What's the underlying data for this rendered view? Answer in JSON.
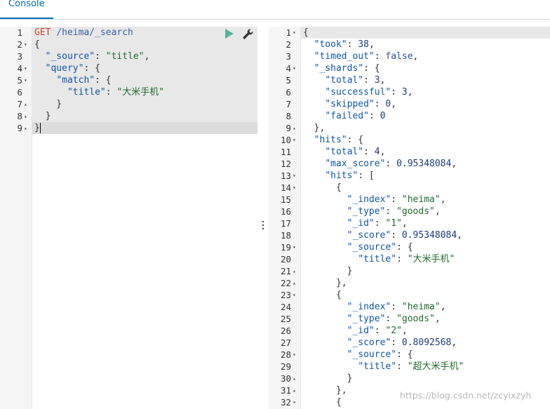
{
  "tabs": {
    "console_label": "Console"
  },
  "request": {
    "lines": [
      [
        {
          "t": "GET ",
          "c": "m"
        },
        {
          "t": "/heima/_search",
          "c": "u"
        }
      ],
      [
        {
          "t": "{",
          "c": "p"
        }
      ],
      [
        {
          "t": "  ",
          "c": "p"
        },
        {
          "t": "\"_source\"",
          "c": "k"
        },
        {
          "t": ": ",
          "c": "p"
        },
        {
          "t": "\"title\"",
          "c": "s"
        },
        {
          "t": ",",
          "c": "p"
        }
      ],
      [
        {
          "t": "  ",
          "c": "p"
        },
        {
          "t": "\"query\"",
          "c": "k"
        },
        {
          "t": ": {",
          "c": "p"
        }
      ],
      [
        {
          "t": "    ",
          "c": "p"
        },
        {
          "t": "\"match\"",
          "c": "k"
        },
        {
          "t": ": {",
          "c": "p"
        }
      ],
      [
        {
          "t": "      ",
          "c": "p"
        },
        {
          "t": "\"title\"",
          "c": "k"
        },
        {
          "t": ": ",
          "c": "p"
        },
        {
          "t": "\"大米手机\"",
          "c": "s"
        }
      ],
      [
        {
          "t": "    }",
          "c": "p"
        }
      ],
      [
        {
          "t": "  }",
          "c": "p"
        }
      ],
      [
        {
          "t": "}",
          "c": "p"
        }
      ]
    ],
    "folds": [
      "",
      "▾",
      "",
      "▾",
      "▾",
      "",
      "▴",
      "▴",
      "▴"
    ]
  },
  "response": {
    "lines": [
      [
        {
          "t": "{",
          "c": "p"
        }
      ],
      [
        {
          "t": "  ",
          "c": "p"
        },
        {
          "t": "\"took\"",
          "c": "k"
        },
        {
          "t": ": ",
          "c": "p"
        },
        {
          "t": "38",
          "c": "n"
        },
        {
          "t": ",",
          "c": "p"
        }
      ],
      [
        {
          "t": "  ",
          "c": "p"
        },
        {
          "t": "\"timed_out\"",
          "c": "k"
        },
        {
          "t": ": ",
          "c": "p"
        },
        {
          "t": "false",
          "c": "b"
        },
        {
          "t": ",",
          "c": "p"
        }
      ],
      [
        {
          "t": "  ",
          "c": "p"
        },
        {
          "t": "\"_shards\"",
          "c": "k"
        },
        {
          "t": ": {",
          "c": "p"
        }
      ],
      [
        {
          "t": "    ",
          "c": "p"
        },
        {
          "t": "\"total\"",
          "c": "k"
        },
        {
          "t": ": ",
          "c": "p"
        },
        {
          "t": "3",
          "c": "n"
        },
        {
          "t": ",",
          "c": "p"
        }
      ],
      [
        {
          "t": "    ",
          "c": "p"
        },
        {
          "t": "\"successful\"",
          "c": "k"
        },
        {
          "t": ": ",
          "c": "p"
        },
        {
          "t": "3",
          "c": "n"
        },
        {
          "t": ",",
          "c": "p"
        }
      ],
      [
        {
          "t": "    ",
          "c": "p"
        },
        {
          "t": "\"skipped\"",
          "c": "k"
        },
        {
          "t": ": ",
          "c": "p"
        },
        {
          "t": "0",
          "c": "n"
        },
        {
          "t": ",",
          "c": "p"
        }
      ],
      [
        {
          "t": "    ",
          "c": "p"
        },
        {
          "t": "\"failed\"",
          "c": "k"
        },
        {
          "t": ": ",
          "c": "p"
        },
        {
          "t": "0",
          "c": "n"
        }
      ],
      [
        {
          "t": "  },",
          "c": "p"
        }
      ],
      [
        {
          "t": "  ",
          "c": "p"
        },
        {
          "t": "\"hits\"",
          "c": "k"
        },
        {
          "t": ": {",
          "c": "p"
        }
      ],
      [
        {
          "t": "    ",
          "c": "p"
        },
        {
          "t": "\"total\"",
          "c": "k"
        },
        {
          "t": ": ",
          "c": "p"
        },
        {
          "t": "4",
          "c": "n"
        },
        {
          "t": ",",
          "c": "p"
        }
      ],
      [
        {
          "t": "    ",
          "c": "p"
        },
        {
          "t": "\"max_score\"",
          "c": "k"
        },
        {
          "t": ": ",
          "c": "p"
        },
        {
          "t": "0.95348084",
          "c": "n"
        },
        {
          "t": ",",
          "c": "p"
        }
      ],
      [
        {
          "t": "    ",
          "c": "p"
        },
        {
          "t": "\"hits\"",
          "c": "k"
        },
        {
          "t": ": [",
          "c": "p"
        }
      ],
      [
        {
          "t": "      {",
          "c": "p"
        }
      ],
      [
        {
          "t": "        ",
          "c": "p"
        },
        {
          "t": "\"_index\"",
          "c": "k"
        },
        {
          "t": ": ",
          "c": "p"
        },
        {
          "t": "\"heima\"",
          "c": "s"
        },
        {
          "t": ",",
          "c": "p"
        }
      ],
      [
        {
          "t": "        ",
          "c": "p"
        },
        {
          "t": "\"_type\"",
          "c": "k"
        },
        {
          "t": ": ",
          "c": "p"
        },
        {
          "t": "\"goods\"",
          "c": "s"
        },
        {
          "t": ",",
          "c": "p"
        }
      ],
      [
        {
          "t": "        ",
          "c": "p"
        },
        {
          "t": "\"_id\"",
          "c": "k"
        },
        {
          "t": ": ",
          "c": "p"
        },
        {
          "t": "\"1\"",
          "c": "s"
        },
        {
          "t": ",",
          "c": "p"
        }
      ],
      [
        {
          "t": "        ",
          "c": "p"
        },
        {
          "t": "\"_score\"",
          "c": "k"
        },
        {
          "t": ": ",
          "c": "p"
        },
        {
          "t": "0.95348084",
          "c": "n"
        },
        {
          "t": ",",
          "c": "p"
        }
      ],
      [
        {
          "t": "        ",
          "c": "p"
        },
        {
          "t": "\"_source\"",
          "c": "k"
        },
        {
          "t": ": {",
          "c": "p"
        }
      ],
      [
        {
          "t": "          ",
          "c": "p"
        },
        {
          "t": "\"title\"",
          "c": "k"
        },
        {
          "t": ": ",
          "c": "p"
        },
        {
          "t": "\"大米手机\"",
          "c": "s"
        }
      ],
      [
        {
          "t": "        }",
          "c": "p"
        }
      ],
      [
        {
          "t": "      },",
          "c": "p"
        }
      ],
      [
        {
          "t": "      {",
          "c": "p"
        }
      ],
      [
        {
          "t": "        ",
          "c": "p"
        },
        {
          "t": "\"_index\"",
          "c": "k"
        },
        {
          "t": ": ",
          "c": "p"
        },
        {
          "t": "\"heima\"",
          "c": "s"
        },
        {
          "t": ",",
          "c": "p"
        }
      ],
      [
        {
          "t": "        ",
          "c": "p"
        },
        {
          "t": "\"_type\"",
          "c": "k"
        },
        {
          "t": ": ",
          "c": "p"
        },
        {
          "t": "\"goods\"",
          "c": "s"
        },
        {
          "t": ",",
          "c": "p"
        }
      ],
      [
        {
          "t": "        ",
          "c": "p"
        },
        {
          "t": "\"_id\"",
          "c": "k"
        },
        {
          "t": ": ",
          "c": "p"
        },
        {
          "t": "\"2\"",
          "c": "s"
        },
        {
          "t": ",",
          "c": "p"
        }
      ],
      [
        {
          "t": "        ",
          "c": "p"
        },
        {
          "t": "\"_score\"",
          "c": "k"
        },
        {
          "t": ": ",
          "c": "p"
        },
        {
          "t": "0.8092568",
          "c": "n"
        },
        {
          "t": ",",
          "c": "p"
        }
      ],
      [
        {
          "t": "        ",
          "c": "p"
        },
        {
          "t": "\"_source\"",
          "c": "k"
        },
        {
          "t": ": {",
          "c": "p"
        }
      ],
      [
        {
          "t": "          ",
          "c": "p"
        },
        {
          "t": "\"title\"",
          "c": "k"
        },
        {
          "t": ": ",
          "c": "p"
        },
        {
          "t": "\"超大米手机\"",
          "c": "s"
        }
      ],
      [
        {
          "t": "        }",
          "c": "p"
        }
      ],
      [
        {
          "t": "      },",
          "c": "p"
        }
      ],
      [
        {
          "t": "      {",
          "c": "p"
        }
      ]
    ],
    "folds": [
      "▾",
      "",
      "",
      "▾",
      "",
      "",
      "",
      "",
      "▴",
      "▾",
      "",
      "",
      "▾",
      "▾",
      "",
      "",
      "",
      "",
      "▾",
      "",
      "▴",
      "▴",
      "▾",
      "",
      "",
      "",
      "",
      "▾",
      "",
      "▴",
      "▴",
      "▾"
    ]
  },
  "watermark": "https://blog.csdn.net/zcyixzyh",
  "colors": {
    "accent": "#006bb4",
    "run": "#54b399"
  }
}
